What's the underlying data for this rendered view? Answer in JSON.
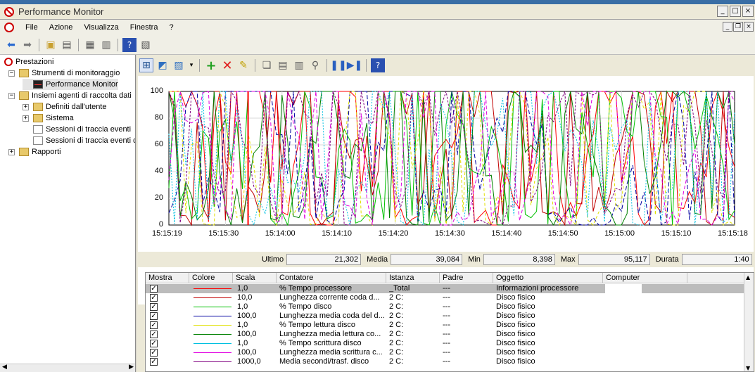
{
  "window": {
    "title": "Performance Monitor"
  },
  "menu": [
    "File",
    "Azione",
    "Visualizza",
    "Finestra",
    "?"
  ],
  "tree": {
    "root": "Prestazioni",
    "items": [
      {
        "label": "Strumenti di monitoraggio",
        "level": 1,
        "expander": "−",
        "icon": "folder-icon"
      },
      {
        "label": "Performance Monitor",
        "level": 2,
        "expander": "",
        "icon": "performance-monitor-icon",
        "selected": true
      },
      {
        "label": "Insiemi agenti di raccolta dati",
        "level": 1,
        "expander": "−",
        "icon": "folder-icon"
      },
      {
        "label": "Definiti dall'utente",
        "level": 2,
        "expander": "+",
        "icon": "folder-icon"
      },
      {
        "label": "Sistema",
        "level": 2,
        "expander": "+",
        "icon": "folder-icon"
      },
      {
        "label": "Sessioni di traccia eventi",
        "level": 2,
        "expander": "",
        "icon": "doc-icon"
      },
      {
        "label": "Sessioni di traccia eventi d",
        "level": 2,
        "expander": "",
        "icon": "doc-icon"
      },
      {
        "label": "Rapporti",
        "level": 1,
        "expander": "+",
        "icon": "folder-icon"
      }
    ]
  },
  "stats": {
    "last_label": "Ultimo",
    "last_value": "21,302",
    "avg_label": "Media",
    "avg_value": "39,084",
    "min_label": "Min",
    "min_value": "8,398",
    "max_label": "Max",
    "max_value": "95,117",
    "duration_label": "Durata",
    "duration_value": "1:40"
  },
  "legend": {
    "headers": [
      "Mostra",
      "Colore",
      "Scala",
      "Contatore",
      "Istanza",
      "Padre",
      "Oggetto",
      "Computer"
    ],
    "rows": [
      {
        "show": "✓",
        "color": "#ff0000",
        "scale": "1,0",
        "counter": "% Tempo processore",
        "instance": "_Total",
        "parent": "---",
        "object": "Informazioni processore"
      },
      {
        "show": "✓",
        "color": "#c00000",
        "scale": "10,0",
        "counter": "Lunghezza corrente coda d...",
        "instance": "2 C:",
        "parent": "---",
        "object": "Disco fisico"
      },
      {
        "show": "✓",
        "color": "#00c000",
        "scale": "1,0",
        "counter": "% Tempo disco",
        "instance": "2 C:",
        "parent": "---",
        "object": "Disco fisico"
      },
      {
        "show": "✓",
        "color": "#0000a0",
        "scale": "100,0",
        "counter": "Lunghezza media coda del d...",
        "instance": "2 C:",
        "parent": "---",
        "object": "Disco fisico"
      },
      {
        "show": "✓",
        "color": "#e0e000",
        "scale": "1,0",
        "counter": "% Tempo lettura disco",
        "instance": "2 C:",
        "parent": "---",
        "object": "Disco fisico"
      },
      {
        "show": "✓",
        "color": "#008000",
        "scale": "100,0",
        "counter": "Lunghezza media lettura co...",
        "instance": "2 C:",
        "parent": "---",
        "object": "Disco fisico"
      },
      {
        "show": "✓",
        "color": "#00c0e0",
        "scale": "1,0",
        "counter": "% Tempo scrittura disco",
        "instance": "2 C:",
        "parent": "---",
        "object": "Disco fisico"
      },
      {
        "show": "✓",
        "color": "#e000e0",
        "scale": "100,0",
        "counter": "Lunghezza media scrittura c...",
        "instance": "2 C:",
        "parent": "---",
        "object": "Disco fisico"
      },
      {
        "show": "✓",
        "color": "#800080",
        "scale": "1000,0",
        "counter": "Media secondi/trasf. disco",
        "instance": "2 C:",
        "parent": "---",
        "object": "Disco fisico"
      }
    ]
  },
  "chart_data": {
    "type": "line",
    "ylim": [
      0,
      100
    ],
    "y_ticks": [
      "100",
      "80",
      "60",
      "40",
      "20",
      "0"
    ],
    "x_ticks": [
      "15:15:19",
      "15:15:30",
      "15:14:00",
      "15:14:10",
      "15:14:20",
      "15:14:30",
      "15:14:40",
      "15:14:50",
      "15:15:00",
      "15:15:10",
      "15:15:18"
    ],
    "series_colors": [
      "#ff0000",
      "#c00000",
      "#00c000",
      "#0000a0",
      "#e0e000",
      "#008000",
      "#00c0e0",
      "#e000e0",
      "#800080"
    ]
  }
}
